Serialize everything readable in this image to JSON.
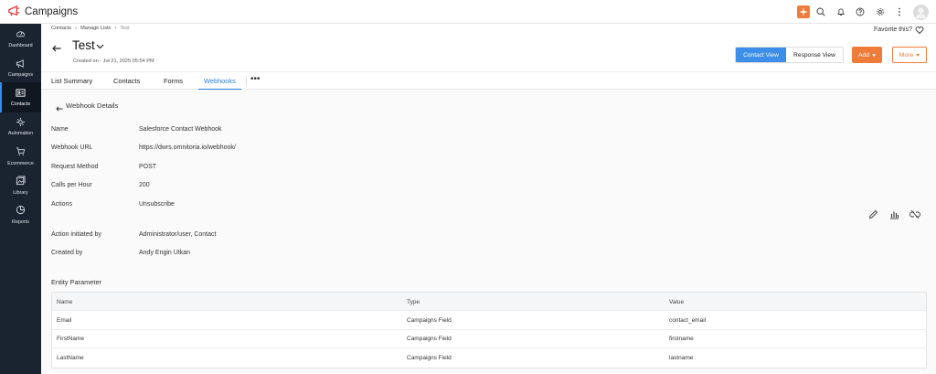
{
  "app": {
    "title": "Campaigns",
    "accent": "#f07c3a",
    "sidebar_bg": "#1a2430",
    "link_color": "#2a7fd4"
  },
  "topbar": {
    "icons": [
      "plus-icon",
      "search-icon",
      "bell-icon",
      "help-icon",
      "gear-icon",
      "kebab-icon",
      "avatar"
    ]
  },
  "sidebar": {
    "items": [
      {
        "label": "Dashboard",
        "icon": "dashboard-icon"
      },
      {
        "label": "Campaigns",
        "icon": "megaphone-icon"
      },
      {
        "label": "Contacts",
        "icon": "contact-card-icon",
        "active": true
      },
      {
        "label": "Automation",
        "icon": "automation-icon"
      },
      {
        "label": "Ecommerce",
        "icon": "cart-icon"
      },
      {
        "label": "Library",
        "icon": "library-icon"
      },
      {
        "label": "Reports",
        "icon": "pie-chart-icon"
      }
    ]
  },
  "breadcrumb": {
    "items": [
      "Contacts",
      "Manage Lists",
      "Test"
    ]
  },
  "favorite": {
    "label": "Favorite this?"
  },
  "header": {
    "title": "Test",
    "created_on": "Created on - Jul 21, 2025 05:54 PM",
    "view_contact": "Contact View",
    "view_response": "Response View",
    "add_label": "Add",
    "more_label": "More"
  },
  "tabs": {
    "items": [
      "List Summary",
      "Contacts",
      "Forms",
      "Webhooks"
    ],
    "active": "Webhooks",
    "more": "•••"
  },
  "webhook": {
    "section_title": "Webhook Details",
    "details": [
      {
        "label": "Name",
        "value": "Salesforce Contact Webhook"
      },
      {
        "label": "Webhook URL",
        "value": "https://dwrs.omnitoria.io/webhook/"
      },
      {
        "label": "Request Method",
        "value": "POST"
      },
      {
        "label": "Calls per Hour",
        "value": "200"
      },
      {
        "label": "Actions",
        "value": "Unsubscribe"
      },
      {
        "label": "Action initiated by",
        "value": "Administrator/user, Contact"
      },
      {
        "label": "Created by",
        "value": "Andy Engin Utkan"
      }
    ],
    "action_icons": [
      "edit-icon",
      "stats-icon",
      "unlink-icon"
    ]
  },
  "entity": {
    "title": "Entity Parameter",
    "columns": [
      "Name",
      "Type",
      "Value"
    ],
    "rows": [
      [
        "Email",
        "Campaigns Field",
        "contact_email"
      ],
      [
        "FirstName",
        "Campaigns Field",
        "firstname"
      ],
      [
        "LastName",
        "Campaigns Field",
        "lastname"
      ]
    ]
  }
}
